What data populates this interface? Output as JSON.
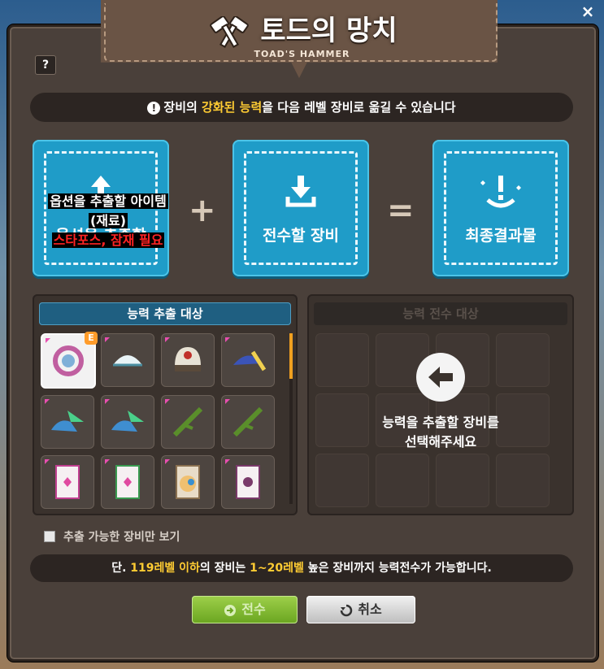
{
  "window": {
    "title": "토드의 망치",
    "subtitle": "TOAD'S HAMMER",
    "close_glyph": "×",
    "help_glyph": "?"
  },
  "notice": {
    "part1": "장비의 ",
    "part2": "강화된 능력",
    "part3": "을 다음 레벨 장비로 옮길 수 있습니다"
  },
  "slots": {
    "source_label": "옵션을 추출할",
    "target_label": "전수할 장비",
    "result_label": "최종결과물",
    "plus": "+",
    "equals": "="
  },
  "annotation": {
    "line1": "옵션을 추출할 아이템",
    "line2": "(재료)",
    "line3": "스타포스, 잠재 필요"
  },
  "extract_panel": {
    "header": "능력 추출 대상",
    "items": [
      {
        "icon": "emblem-ring-icon",
        "selected": true,
        "badge": "E"
      },
      {
        "icon": "bandana-icon"
      },
      {
        "icon": "helmet-icon"
      },
      {
        "icon": "feather-hat-icon"
      },
      {
        "icon": "winged-shoes-icon"
      },
      {
        "icon": "winged-shoes-icon"
      },
      {
        "icon": "branch-weapon-icon"
      },
      {
        "icon": "branch-weapon-icon"
      },
      {
        "icon": "pink-card-icon"
      },
      {
        "icon": "pink-card-icon"
      },
      {
        "icon": "face-card-icon"
      },
      {
        "icon": "white-card-icon"
      }
    ]
  },
  "transfer_panel": {
    "header": "능력 전수 대상",
    "empty_line1": "능력을 추출할 장비를",
    "empty_line2": "선택해주세요"
  },
  "filter": {
    "label": "추출 가능한 장비만 보기",
    "checked": false
  },
  "footer": {
    "p1": "단. ",
    "p2": "119레벨 이하",
    "p3": "의 장비는 ",
    "p4": "1~20레벨",
    "p5": " 높은 장비까지 능력전수가 가능합니다."
  },
  "buttons": {
    "transfer": "전수",
    "cancel": "취소"
  },
  "colors": {
    "accent_gold": "#ffcc33",
    "slot_blue": "#1f9cc8",
    "frame_brown": "#4a403a",
    "annotation_red": "#ff2323"
  }
}
